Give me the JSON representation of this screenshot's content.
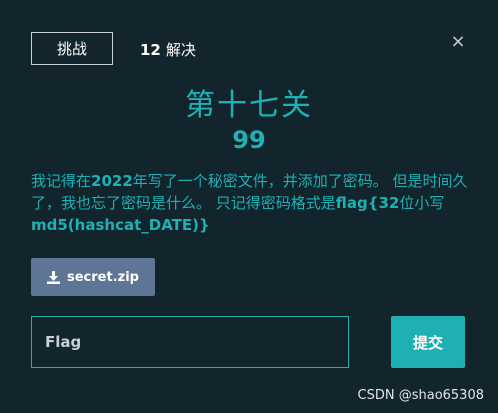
{
  "tabs": {
    "challenge_label": "挑战",
    "solves_count": "12",
    "solves_label": "解决"
  },
  "close_glyph": "×",
  "challenge": {
    "title": "第十七关",
    "points": "99",
    "description": {
      "part1": "我记得在",
      "year": "2022",
      "part2": "年写了一个秘密文件，并添加了密码。 但是时间久了，我也忘了密码是什么。 只记得密码格式是",
      "format1": "flag{32",
      "part3": "位小写",
      "format2": "md5(hashcat_DATE)}"
    },
    "download_label": "secret.zip",
    "download_icon": "download-icon"
  },
  "flag_input": {
    "placeholder": "Flag",
    "value": ""
  },
  "submit_label": "提交",
  "watermark": "CSDN @shao65308",
  "colors": {
    "background": "#13252c",
    "accent": "#1fb0b4",
    "download_bg": "#5e7596"
  }
}
